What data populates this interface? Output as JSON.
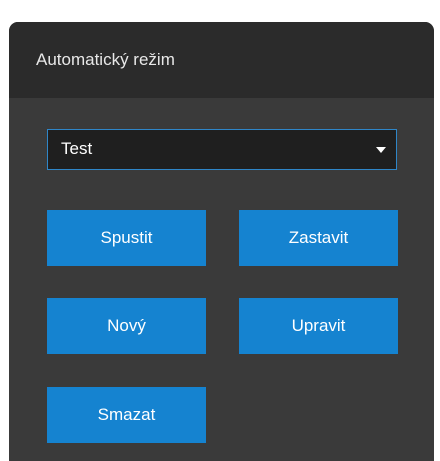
{
  "panel": {
    "title": "Automatický režim"
  },
  "mode_select": {
    "value": "Test",
    "caret_icon": "caret-down-icon"
  },
  "buttons": {
    "start": "Spustit",
    "stop": "Zastavit",
    "new": "Nový",
    "edit": "Upravit",
    "delete": "Smazat"
  },
  "colors": {
    "accent": "#1583d0",
    "panel_bg": "#3a3a3a",
    "header_bg": "#2b2b2b",
    "select_border": "#2f86c8"
  }
}
